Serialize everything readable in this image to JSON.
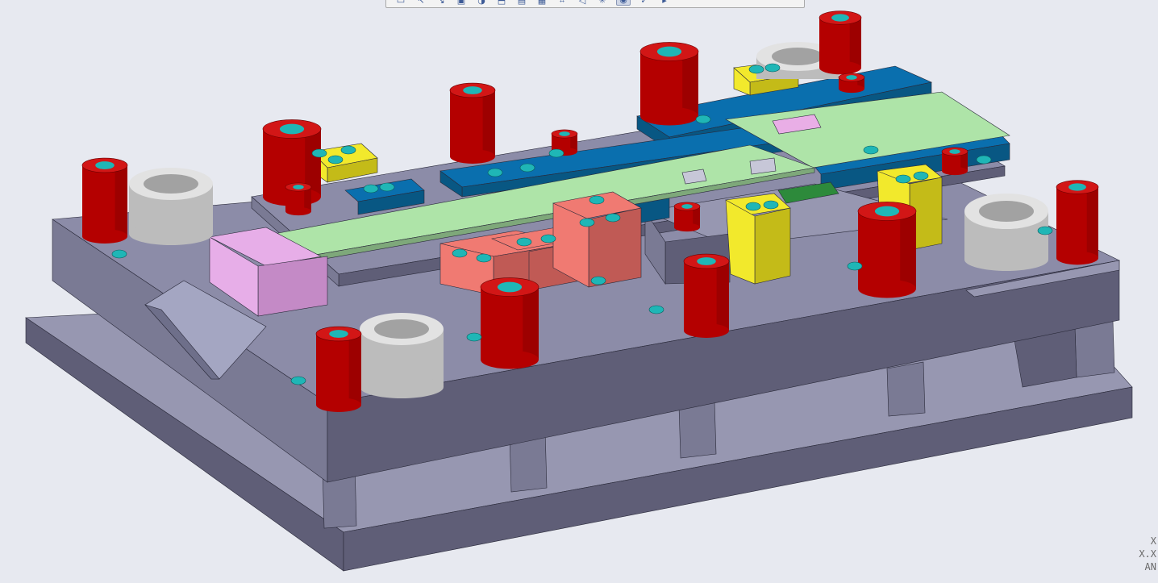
{
  "app": {
    "background": "#e7e9f0"
  },
  "toolbar": {
    "buttons": [
      {
        "name": "repaint",
        "icon": "repaint-icon",
        "glyph": "▭"
      },
      {
        "name": "zoom-in",
        "icon": "zoom-in-icon",
        "glyph": "↖"
      },
      {
        "name": "zoom-out",
        "icon": "zoom-out-icon",
        "glyph": "↘"
      },
      {
        "name": "refit",
        "icon": "refit-icon",
        "glyph": "▣"
      },
      {
        "name": "display-style",
        "icon": "display-style-icon",
        "glyph": "◑"
      },
      {
        "name": "saved-orientations",
        "icon": "saved-view-icon",
        "glyph": "⬒"
      },
      {
        "name": "view-manager",
        "icon": "view-manager-icon",
        "glyph": "▤"
      },
      {
        "name": "layers",
        "icon": "layers-icon",
        "glyph": "▦"
      },
      {
        "name": "datum-display",
        "icon": "datum-display-icon",
        "glyph": "⌗"
      },
      {
        "name": "annotation-display",
        "icon": "annotation-icon",
        "glyph": "◁"
      },
      {
        "name": "spin-center",
        "icon": "spin-center-icon",
        "glyph": "✳"
      },
      {
        "name": "appearance",
        "icon": "appearance-icon",
        "glyph": "◉"
      },
      {
        "name": "model-display",
        "icon": "model-display-icon",
        "glyph": "✓"
      },
      {
        "name": "more",
        "icon": "more-icon",
        "glyph": "▸"
      }
    ]
  },
  "orientation_indicator": {
    "lines": [
      "X",
      "X.X",
      "AN"
    ]
  },
  "colors": {
    "plate_top": "#8c8ca8",
    "plate_front": "#5f5e77",
    "plate_side": "#7a7a94",
    "plate_top_light": "#9797b1",
    "pillar_red": "#b40000",
    "pillar_red_top": "#d21616",
    "hole_teal": "#1fb6b6",
    "rail_blue": "#0a6fae",
    "rail_blue_dark": "#085783",
    "strip_green": "#aee4a8",
    "yellow_block": "#f2e92c",
    "yellow_block_dark": "#c4bb18",
    "salmon_block": "#f07a72",
    "salmon_block_dark": "#c05a55",
    "pink_block": "#e7aee8",
    "pink_block_dark": "#c48ac6",
    "bushing_gray": "#bcbcbc",
    "dark_green": "#2d8a3b"
  }
}
